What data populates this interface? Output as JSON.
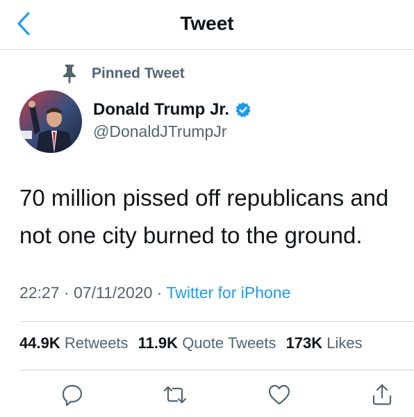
{
  "header": {
    "title": "Tweet",
    "back_icon": "chevron-left-icon"
  },
  "pinned": {
    "label": "Pinned Tweet",
    "icon": "pin-icon"
  },
  "author": {
    "name": "Donald Trump Jr.",
    "handle": "@DonaldJTrumpJr",
    "verified_icon": "verified-badge-icon"
  },
  "tweet": {
    "line1": "70 million pissed off republicans and",
    "line2": "not one city burned to the ground."
  },
  "meta": {
    "time": "22:27",
    "sep1": " · ",
    "date": "07/11/2020",
    "sep2": " · ",
    "source": "Twitter for iPhone"
  },
  "stats": {
    "retweets_count": "44.9K",
    "retweets_label": "Retweets",
    "quotes_count": "11.9K",
    "quotes_label": "Quote Tweets",
    "likes_count": "173K",
    "likes_label": "Likes"
  },
  "actions": {
    "reply_icon": "reply-icon",
    "retweet_icon": "retweet-icon",
    "like_icon": "heart-icon",
    "share_icon": "share-icon"
  },
  "colors": {
    "accent": "#1d9bf0",
    "text": "#0f1419",
    "secondary": "#536471",
    "divider": "#cfd9de"
  }
}
